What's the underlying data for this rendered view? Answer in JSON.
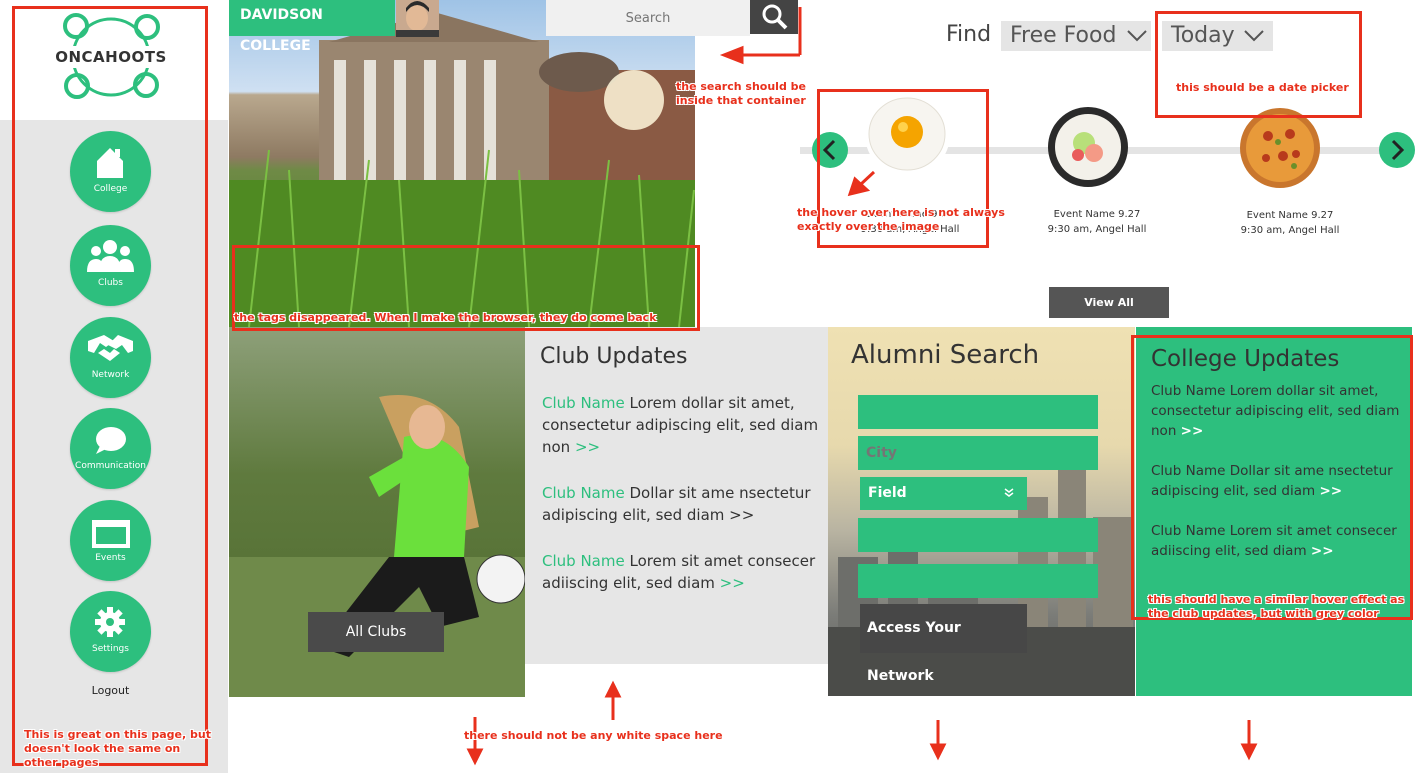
{
  "brand": {
    "logo_text": "ONCAHOOTS",
    "accent": "#2dbf7e"
  },
  "sidebar": {
    "items": [
      {
        "label": "College",
        "icon": "home-icon"
      },
      {
        "label": "Clubs",
        "icon": "people-icon"
      },
      {
        "label": "Network",
        "icon": "handshake-icon"
      },
      {
        "label": "Communication",
        "icon": "speech-bubble-icon"
      },
      {
        "label": "Events",
        "icon": "calendar-window-icon"
      },
      {
        "label": "Settings",
        "icon": "gear-icon"
      }
    ],
    "logout": "Logout"
  },
  "header": {
    "college": "DAVIDSON COLLEGE",
    "search_placeholder": "Search"
  },
  "find": {
    "label": "Find",
    "category": "Free Food",
    "date": "Today"
  },
  "events": [
    {
      "image": "fried-egg",
      "name": "Event Name 9.27",
      "detail": "9:30 am, Angel Hall"
    },
    {
      "image": "sushi-roll",
      "name": "Event Name 9.27",
      "detail": "9:30 am, Angel Hall"
    },
    {
      "image": "pizza",
      "name": "Event Name 9.27",
      "detail": "9:30 am, Angel Hall"
    }
  ],
  "view_all": "View All",
  "all_clubs": "All Clubs",
  "club_updates": {
    "title": "Club Updates",
    "items": [
      {
        "name": "Club Name",
        "text": "Lorem dollar sit amet, consectetur adipiscing elit, sed diam non",
        "more": ">>"
      },
      {
        "name": "Club Name",
        "text": "Dollar sit ame nsectetur adipiscing elit, sed diam >>",
        "more": ""
      },
      {
        "name": "Club Name",
        "text": "Lorem sit amet consecer adiiscing elit, sed diam",
        "more": ">>"
      }
    ]
  },
  "alumni": {
    "title": "Alumni Search",
    "city": "City",
    "field": "Field",
    "access": "Access Your Network"
  },
  "college_updates": {
    "title": "College Updates",
    "items": [
      {
        "text": "Club Name Lorem dollar sit amet, consectetur adipiscing elit, sed diam non",
        "more": ">>"
      },
      {
        "text": "Club Name Dollar sit ame nsectetur adipiscing elit, sed diam",
        "more": ">>"
      },
      {
        "text": "Club Name Lorem sit amet consecer adiiscing elit, sed diam",
        "more": ">>"
      }
    ]
  },
  "annotations": {
    "search": "the search should be inside that container",
    "date": "this should be a date picker",
    "hover": "the hover over here is not always exactly over the image",
    "hover_partial": "9.27",
    "tags": "the tags disappeared. When I make the browser, they do come back",
    "college_hover": "this should have a similar hover effect as the club updates, but with grey color",
    "whitespace": "there should not be any white space here",
    "sidebar": "This is great on this page, but doesn't look the same on other pages"
  }
}
